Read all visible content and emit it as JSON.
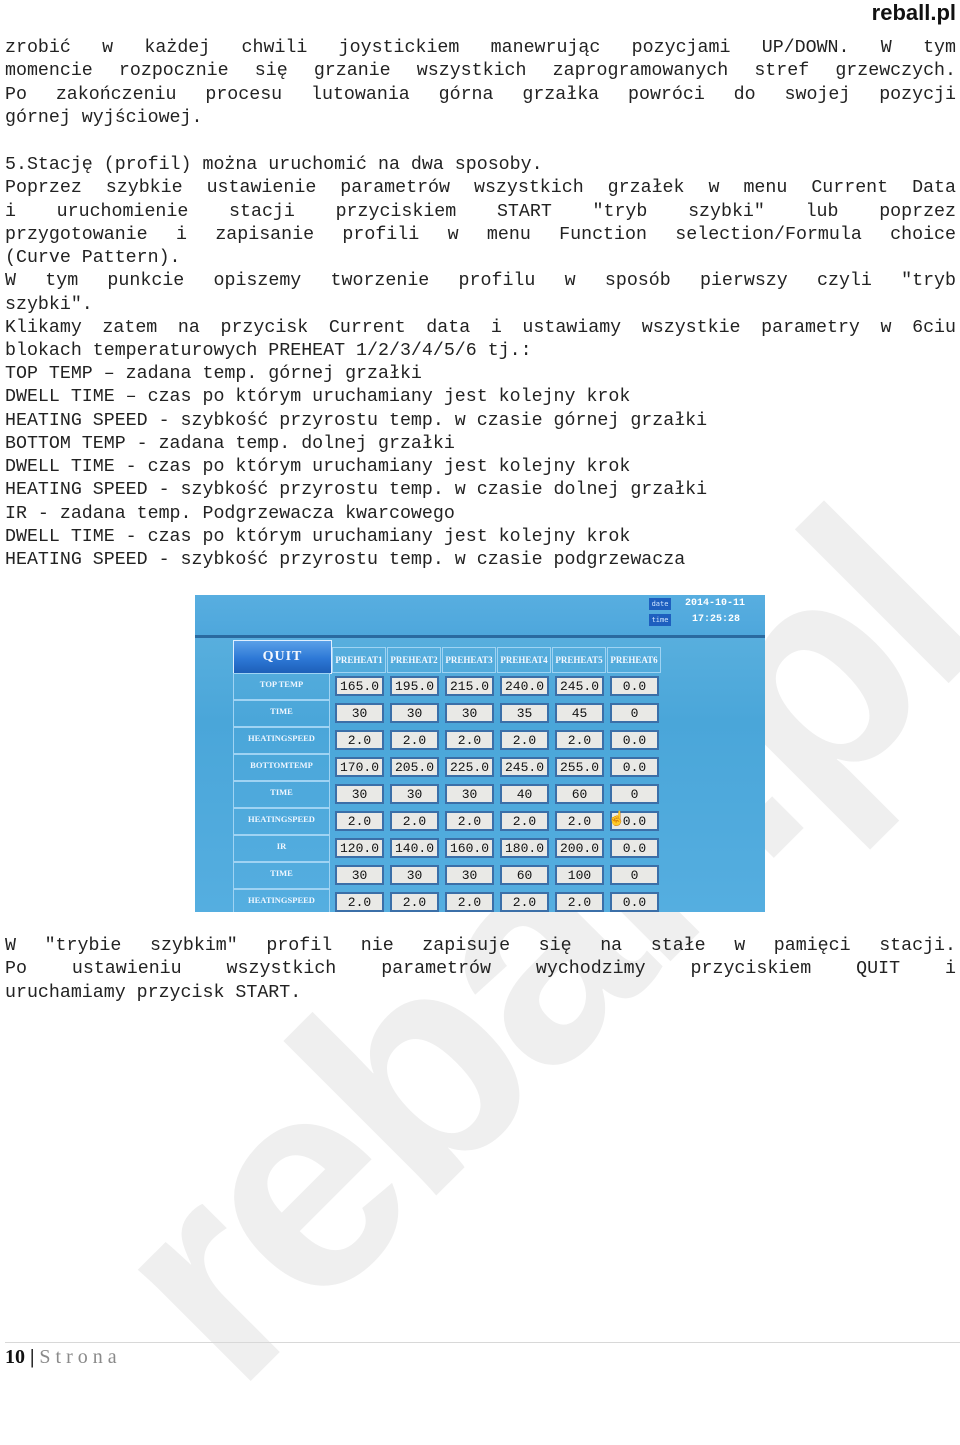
{
  "header": {
    "brand": "reball.pl"
  },
  "watermark": "reball.pl",
  "paragraphs_top": [
    "zrobić w każdej chwili joystickiem manewrując pozycjami UP/DOWN. W tym",
    "momencie rozpocznie się grzanie wszystkich zaprogramowanych stref grzewczych.",
    "Po zakończeniu procesu lutowania górna grzałka powróci do swojej pozycji",
    "górnej wyjściowej."
  ],
  "section5": {
    "heading": "5.Stację (profil) można uruchomić na dwa sposoby.",
    "lines": [
      "Poprzez szybkie ustawienie parametrów wszystkich grzałek w menu Current Data",
      "i uruchomienie stacji przyciskiem START \"tryb szybki\" lub poprzez",
      "przygotowanie i zapisanie profili w menu Function selection/Formula choice",
      "(Curve Pattern).",
      "W tym punkcie opiszemy tworzenie profilu w sposób pierwszy czyli \"tryb",
      "szybki\".",
      "Klikamy zatem na przycisk Current data i ustawiamy wszystkie parametry w 6ciu",
      "blokach temperaturowych PREHEAT 1/2/3/4/5/6 tj.:"
    ]
  },
  "definitions": [
    "TOP TEMP – zadana temp. górnej grzałki",
    "DWELL TIME – czas po którym uruchamiany jest kolejny krok",
    "HEATING SPEED - szybkość przyrostu temp. w czasie górnej grzałki",
    "BOTTOM TEMP - zadana temp. dolnej grzałki",
    "DWELL TIME - czas po którym uruchamiany jest kolejny krok",
    "HEATING SPEED - szybkość przyrostu temp. w czasie dolnej grzałki",
    "IR - zadana temp. Podgrzewacza kwarcowego",
    "DWELL TIME - czas po którym uruchamiany jest kolejny krok",
    "HEATING SPEED - szybkość przyrostu temp. w czasie podgrzewacza"
  ],
  "screen": {
    "date_label": "date",
    "date_value": "2014-10-11",
    "time_label": "time",
    "time_value": "17:25:28",
    "quit_label": "QUIT",
    "columns": [
      "PREHEAT1",
      "PREHEAT2",
      "PREHEAT3",
      "PREHEAT4",
      "PREHEAT5",
      "PREHEAT6"
    ],
    "rows": [
      {
        "label": "TOP TEMP",
        "values": [
          "165.0",
          "195.0",
          "215.0",
          "240.0",
          "245.0",
          "0.0"
        ]
      },
      {
        "label": "TIME",
        "values": [
          "30",
          "30",
          "30",
          "35",
          "45",
          "0"
        ]
      },
      {
        "label": "HEATINGSPEED",
        "values": [
          "2.0",
          "2.0",
          "2.0",
          "2.0",
          "2.0",
          "0.0"
        ]
      },
      {
        "label": "BOTTOMTEMP",
        "values": [
          "170.0",
          "205.0",
          "225.0",
          "245.0",
          "255.0",
          "0.0"
        ]
      },
      {
        "label": "TIME",
        "values": [
          "30",
          "30",
          "30",
          "40",
          "60",
          "0"
        ]
      },
      {
        "label": "HEATINGSPEED",
        "values": [
          "2.0",
          "2.0",
          "2.0",
          "2.0",
          "2.0",
          "0.0"
        ]
      },
      {
        "label": "IR",
        "values": [
          "120.0",
          "140.0",
          "160.0",
          "180.0",
          "200.0",
          "0.0"
        ]
      },
      {
        "label": "TIME",
        "values": [
          "30",
          "30",
          "30",
          "60",
          "100",
          "0"
        ]
      },
      {
        "label": "HEATINGSPEED",
        "values": [
          "2.0",
          "2.0",
          "2.0",
          "2.0",
          "2.0",
          "0.0"
        ]
      }
    ]
  },
  "paragraphs_bottom": [
    "W \"trybie szybkim\" profil nie zapisuje się na stałe w pamięci stacji.",
    "Po ustawieniu wszystkich parametrów wychodzimy przyciskiem QUIT i",
    "uruchamiamy przycisk START."
  ],
  "footer": {
    "page_number": "10",
    "separator": "|",
    "label": "Strona"
  },
  "colors": {
    "screen_blue": "#4aa6d9",
    "quit_blue": "#2d78d6",
    "cell_bg": "#e9e9e6",
    "text": "#222222"
  }
}
